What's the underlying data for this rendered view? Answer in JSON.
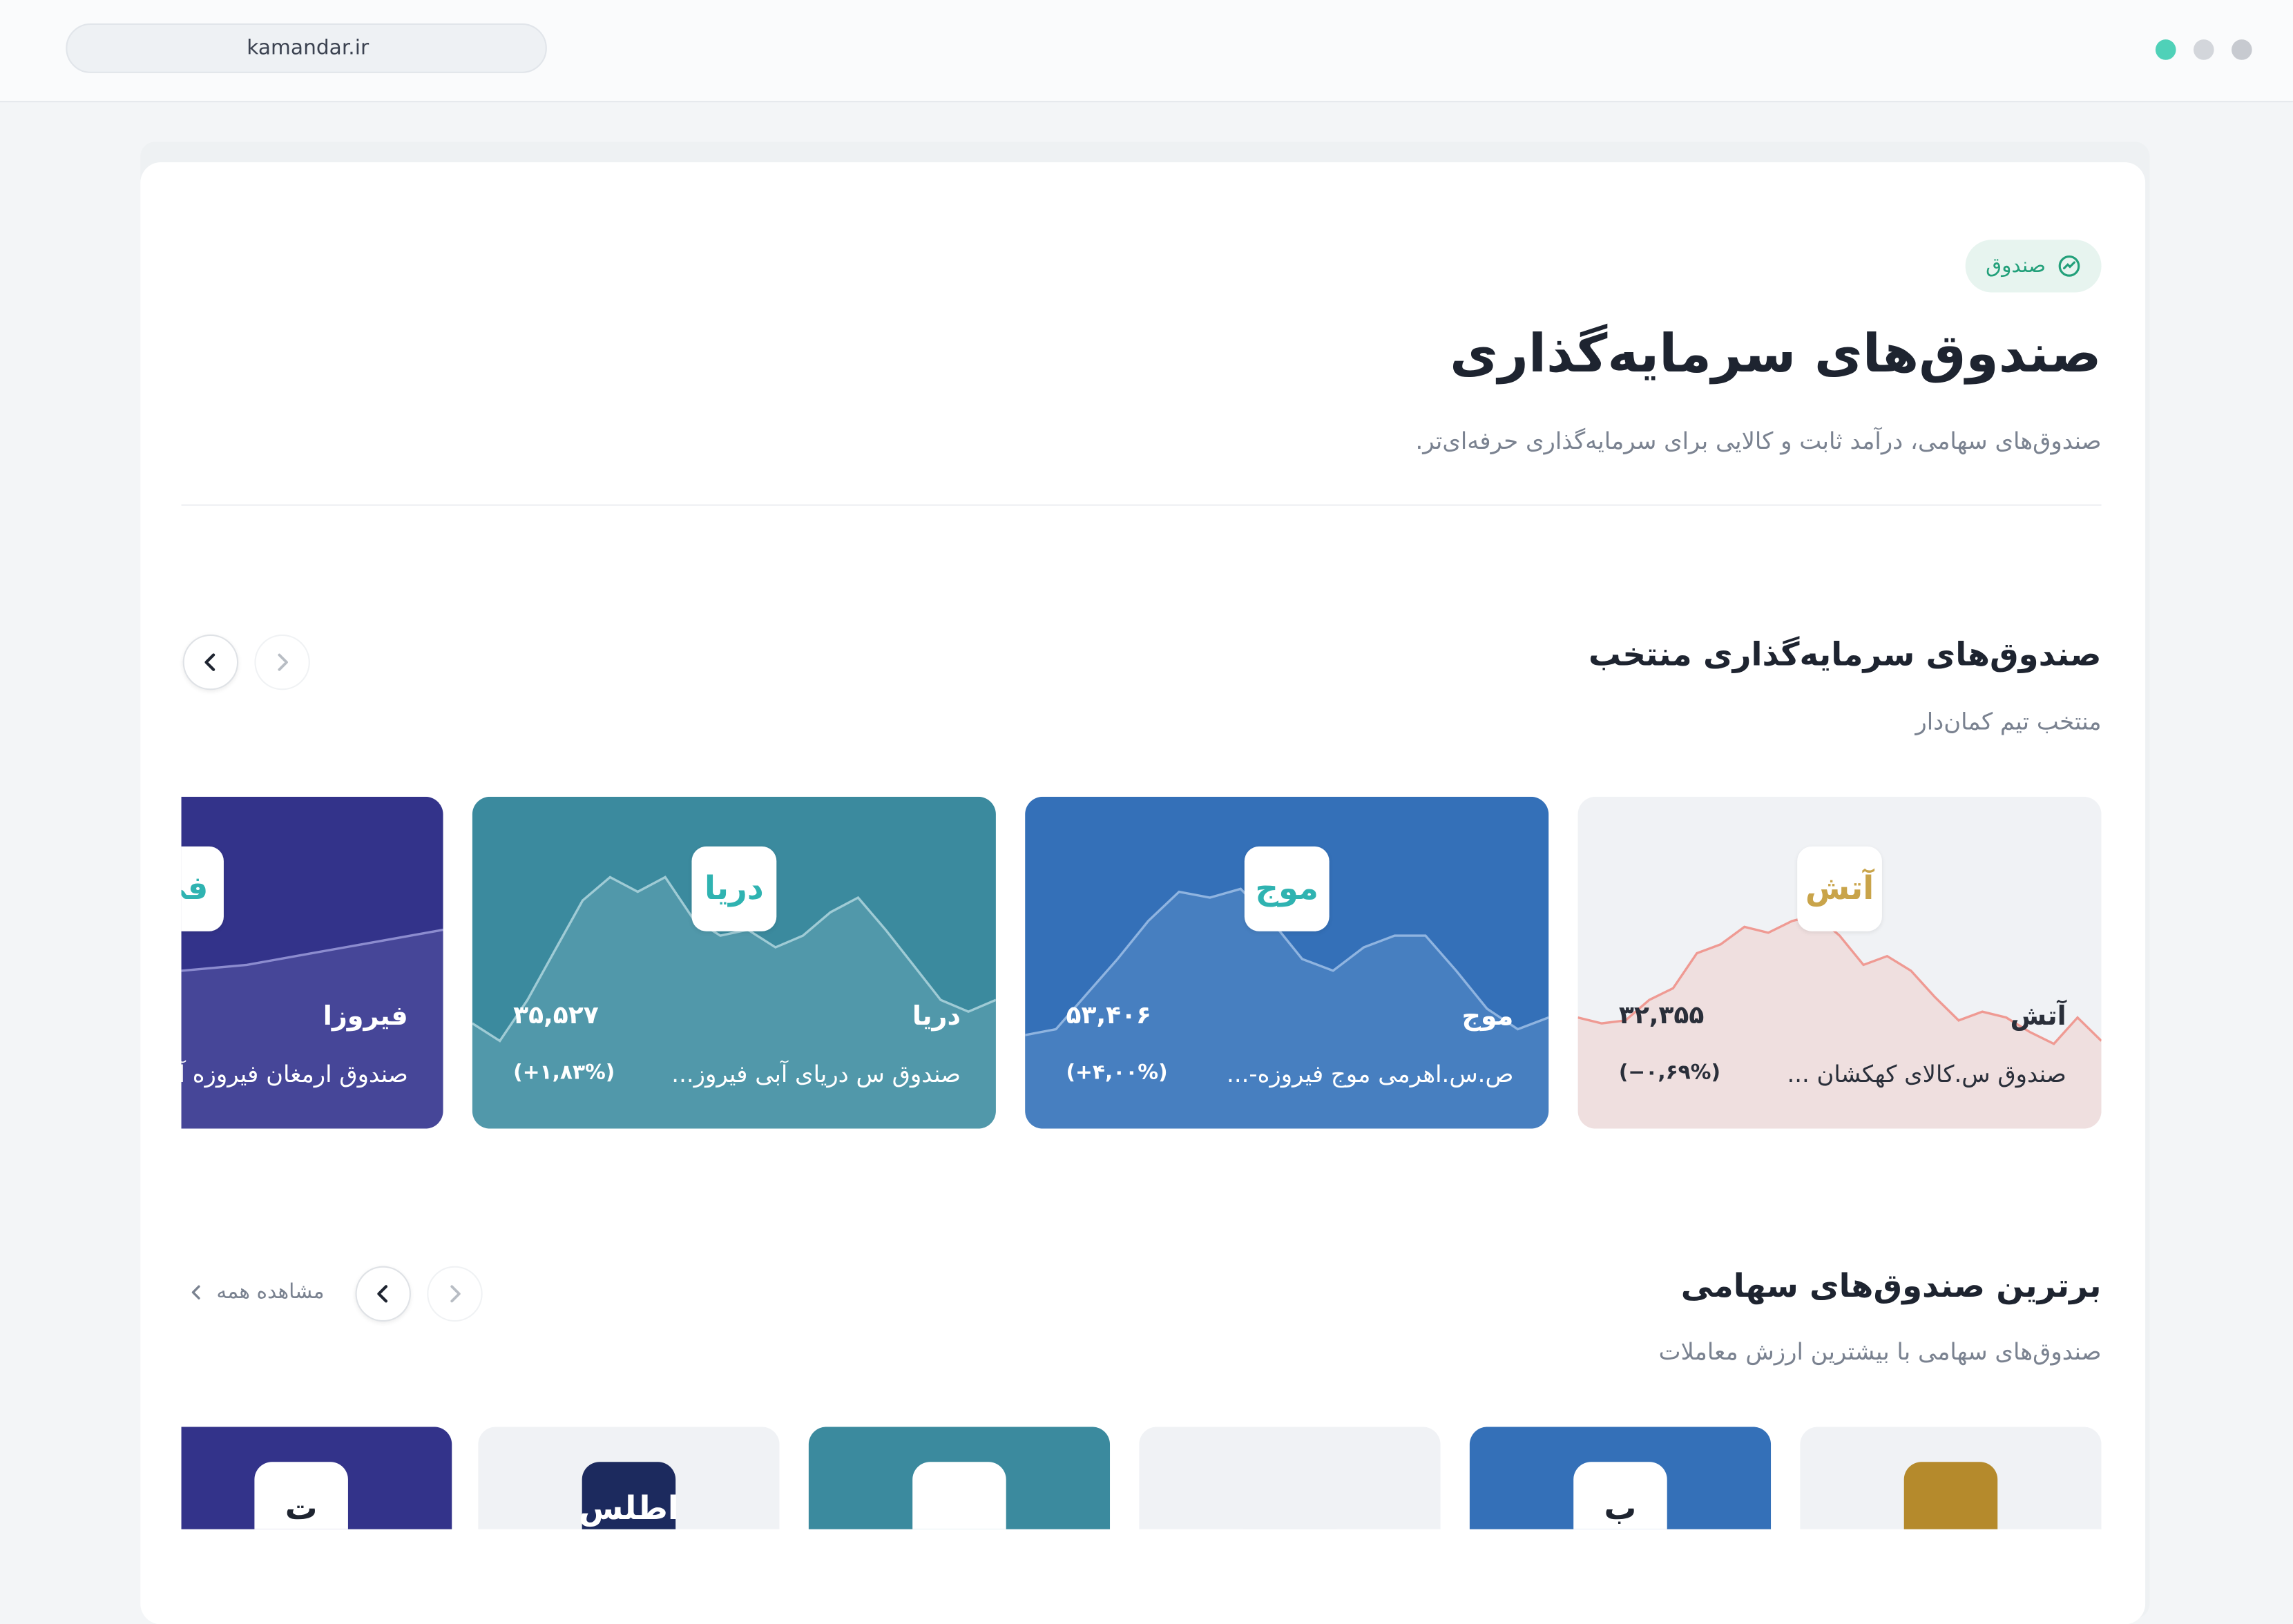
{
  "browser": {
    "url": "kamandar.ir",
    "dot_colors": [
      "#4fd1b8",
      "#d3d6db",
      "#c7cad0"
    ]
  },
  "hero": {
    "chip_label": "صندوق",
    "chip_icon": "trend-circle-icon",
    "title": "صندوق‌های سرمایه‌گذاری",
    "subtitle": "صندوق‌های سهامی، درآمد ثابت و کالایی برای سرمایه‌گذاری حرفه‌ای‌تر."
  },
  "featured": {
    "title": "صندوق‌های سرمایه‌گذاری منتخب",
    "subtitle": "منتخب تیم کمان‌دار",
    "funds": [
      {
        "name": "آتش",
        "full_name": "صندوق س.کالای کهکشان ...",
        "price": "۳۲,۳۵۵",
        "change": "(−۰,۶۹%)",
        "logo_text": "آتش",
        "bg": "#f0f2f5",
        "text_color": "#2a2f3a",
        "line_color": "#ef9a93",
        "logo_color": "#c9a44a",
        "trend": [
          12,
          10,
          11,
          18,
          22,
          34,
          37,
          43,
          41,
          45,
          47,
          40,
          30,
          33,
          28,
          19,
          11,
          14,
          12,
          7,
          3,
          12,
          4
        ]
      },
      {
        "name": "موج",
        "full_name": "ص.س.اهرمی موج فیروزه-...",
        "price": "۵۳,۴۰۶",
        "change": "(+۴,۰۰%)",
        "logo_text": "موج",
        "bg": "#3470b8",
        "text_color": "#ffffff",
        "line_color": "#8fb4e0",
        "logo_color": "#2fb3b1",
        "trend": [
          6,
          8,
          20,
          32,
          45,
          55,
          53,
          56,
          45,
          32,
          28,
          36,
          40,
          40,
          28,
          15,
          8,
          12
        ]
      },
      {
        "name": "دریا",
        "full_name": "صندوق س دریای آبی فیروز...",
        "price": "۳۵,۵۲۷",
        "change": "(+۱,۸۳%)",
        "logo_text": "دریا",
        "bg": "#3b8a9e",
        "text_color": "#ffffff",
        "line_color": "#9fcbd5",
        "logo_color": "#2fb3b1",
        "trend": [
          10,
          4,
          18,
          35,
          52,
          60,
          55,
          60,
          46,
          40,
          42,
          36,
          40,
          48,
          53,
          42,
          30,
          18,
          14,
          18
        ]
      },
      {
        "name": "فیروزا",
        "full_name": "صندوق ارمغان فیروزه آسیا",
        "price": "",
        "change": "",
        "logo_text": "فی",
        "bg": "#33338a",
        "text_color": "#ffffff",
        "line_color": "#8c8ccf",
        "logo_color": "#2fb3b1",
        "trend": [
          20,
          22,
          24,
          26,
          28,
          30,
          34,
          38,
          42
        ]
      }
    ]
  },
  "equity": {
    "title": "برترین صندوق‌های سهامی",
    "subtitle": "صندوق‌های سهامی با بیشترین ارزش معاملات",
    "view_all": "مشاهده همه",
    "cards": [
      {
        "bg": "#f0f2f5",
        "logo_bg": "#b58a2c",
        "logo_text": "",
        "logo_color": "#ffffff"
      },
      {
        "bg": "#3470b8",
        "logo_bg": "#ffffff",
        "logo_text": "ب",
        "logo_color": "#1e2430"
      },
      {
        "bg": "#f0f2f5",
        "logo_bg": "#f0f2f5",
        "logo_text": "",
        "logo_color": "#2b7a4b"
      },
      {
        "bg": "#3b8a9e",
        "logo_bg": "#ffffff",
        "logo_text": "",
        "logo_color": "#2b8a5a"
      },
      {
        "bg": "#f0f2f5",
        "logo_bg": "#1c2a5e",
        "logo_text": "اطلس",
        "logo_color": "#ffffff"
      },
      {
        "bg": "#33338a",
        "logo_bg": "#ffffff",
        "logo_text": "ت",
        "logo_color": "#1e2430"
      }
    ]
  }
}
